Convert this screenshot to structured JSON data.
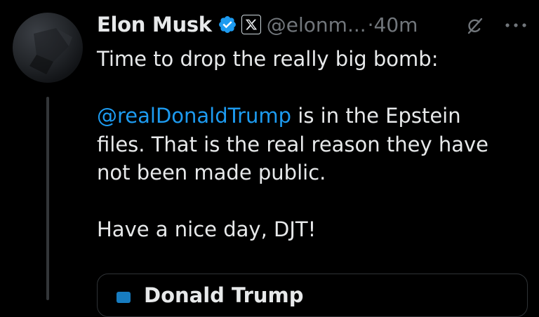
{
  "tweet": {
    "author_name": "Elon Musk",
    "handle": "@elonm...",
    "separator": "·",
    "timestamp": "40m",
    "icons": {
      "verified": "verified-badge-icon",
      "affiliation": "x-logo-icon",
      "grok": "grok-icon",
      "more": "more-icon"
    },
    "text": {
      "line1": "Time to drop the really big bomb:",
      "mention": "@realDonaldTrump",
      "line2_rest": " is in the Epstein",
      "line3": "files. That is the real reason they have",
      "line4": "not been made public.",
      "line5": "Have a nice day, DJT!"
    }
  },
  "colors": {
    "background": "#000000",
    "text": "#e7e9ea",
    "secondary": "#71767b",
    "link": "#1d9bf0",
    "verified": "#1d9bf0",
    "border": "#2f3336"
  },
  "quote_card": {
    "peek_icon": "quote-card-icon",
    "peek_text": "Donald Trump"
  }
}
